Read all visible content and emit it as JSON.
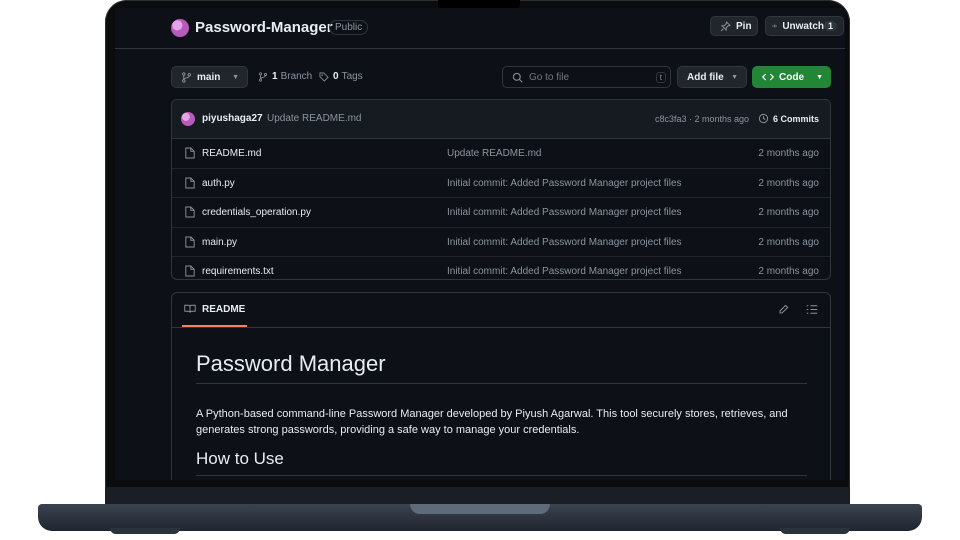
{
  "repo": {
    "name": "Password-Manager",
    "visibility": "Public",
    "pin_label": "Pin",
    "watch_label": "Unwatch",
    "watch_count": "1"
  },
  "toolbar": {
    "branch": "main",
    "branch_count": "1",
    "branch_label": "Branch",
    "tag_count": "0",
    "tag_label": "Tags",
    "goto_placeholder": "Go to file",
    "goto_shortcut": "t",
    "add_file_label": "Add file",
    "code_label": "Code"
  },
  "latest_commit": {
    "user": "piyushaga27",
    "message": "Update README.md",
    "hash_time": "c8c3fa3 · 2 months ago",
    "commits_label": "6 Commits"
  },
  "files": [
    {
      "name": "README.md",
      "message": "Update README.md",
      "time": "2 months ago"
    },
    {
      "name": "auth.py",
      "message": "Initial commit: Added Password Manager project files",
      "time": "2 months ago"
    },
    {
      "name": "credentials_operation.py",
      "message": "Initial commit: Added Password Manager project files",
      "time": "2 months ago"
    },
    {
      "name": "main.py",
      "message": "Initial commit: Added Password Manager project files",
      "time": "2 months ago"
    },
    {
      "name": "requirements.txt",
      "message": "Initial commit: Added Password Manager project files",
      "time": "2 months ago"
    }
  ],
  "readme": {
    "tab_label": "README",
    "title": "Password Manager",
    "description": "A Python-based command-line Password Manager developed by Piyush Agarwal. This tool securely stores, retrieves, and generates strong passwords, providing a safe way to manage your credentials.",
    "section_heading": "How to Use"
  },
  "colors": {
    "background": "#0d1117",
    "border": "#30363d",
    "code_button": "#238636",
    "tab_underline": "#f78166"
  }
}
